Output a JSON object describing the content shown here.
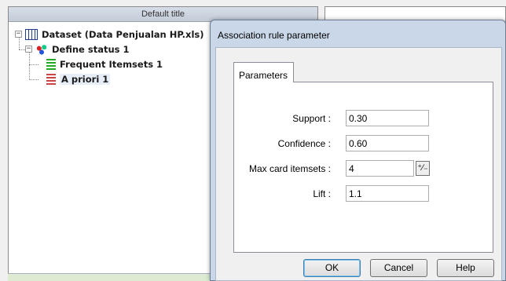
{
  "tree_panel": {
    "title": "Default title",
    "nodes": [
      {
        "label": "Dataset (Data Penjualan HP.xls)",
        "icon": "table-icon",
        "expander": "−"
      },
      {
        "label": "Define status 1",
        "icon": "status-icon",
        "expander": "−"
      },
      {
        "label": "Frequent Itemsets 1",
        "icon": "frequent-itemsets-icon"
      },
      {
        "label": "A priori 1",
        "icon": "apriori-icon"
      }
    ]
  },
  "dialog": {
    "title": "Association rule parameter",
    "tab_label": "Parameters",
    "fields": {
      "support_label": "Support :",
      "support_value": "0.30",
      "confidence_label": "Confidence :",
      "confidence_value": "0.60",
      "max_card_label": "Max card itemsets :",
      "max_card_value": "4",
      "lift_label": "Lift :",
      "lift_value": "1.1"
    },
    "buttons": {
      "ok": "OK",
      "cancel": "Cancel",
      "help": "Help"
    }
  },
  "colors": {
    "dialog_frame": "#c9d7e8",
    "selection": "#e8eef8",
    "bottom_strip": "#dcebd2"
  }
}
